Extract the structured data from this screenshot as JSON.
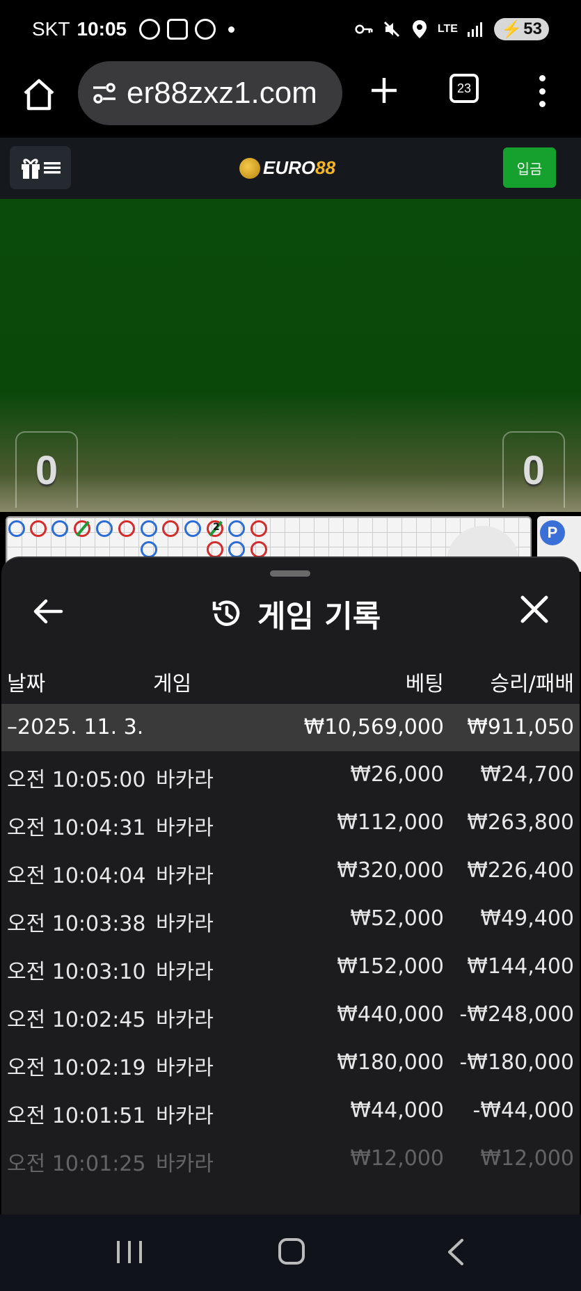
{
  "status_bar": {
    "carrier": "SKT",
    "time": "10:05",
    "network": "LTE",
    "battery": "53"
  },
  "browser": {
    "url": "er88zxz1.com",
    "tab_count": "23"
  },
  "site": {
    "logo_a": "EURO",
    "logo_b": "88",
    "deposit_label": "입금"
  },
  "game": {
    "score_left": "0",
    "score_right": "0",
    "badge": "P",
    "roadmap_tie_count": "2"
  },
  "sheet": {
    "title": "게임 기록",
    "columns": {
      "date": "날짜",
      "game": "게임",
      "bet": "베팅",
      "win_loss": "승리/패배"
    },
    "summary": {
      "date": "–2025. 11. 3.",
      "bet": "₩10,569,000",
      "win_loss": "₩911,050"
    },
    "rows": [
      {
        "time": "오전 10:05:00",
        "game": "바카라",
        "bet": "₩26,000",
        "win_loss": "₩24,700"
      },
      {
        "time": "오전 10:04:31",
        "game": "바카라",
        "bet": "₩112,000",
        "win_loss": "₩263,800"
      },
      {
        "time": "오전 10:04:04",
        "game": "바카라",
        "bet": "₩320,000",
        "win_loss": "₩226,400"
      },
      {
        "time": "오전 10:03:38",
        "game": "바카라",
        "bet": "₩52,000",
        "win_loss": "₩49,400"
      },
      {
        "time": "오전 10:03:10",
        "game": "바카라",
        "bet": "₩152,000",
        "win_loss": "₩144,400"
      },
      {
        "time": "오전 10:02:45",
        "game": "바카라",
        "bet": "₩440,000",
        "win_loss": "-₩248,000"
      },
      {
        "time": "오전 10:02:19",
        "game": "바카라",
        "bet": "₩180,000",
        "win_loss": "-₩180,000"
      },
      {
        "time": "오전 10:01:51",
        "game": "바카라",
        "bet": "₩44,000",
        "win_loss": "-₩44,000"
      },
      {
        "time": "오전 10:01:25",
        "game": "바카라",
        "bet": "₩12,000",
        "win_loss": "₩12,000"
      }
    ]
  },
  "colors": {
    "deposit_green": "#16a02e",
    "logo_gold": "#f5b523",
    "table_green": "#0a4a0a",
    "banker_red": "#d42b2b",
    "player_blue": "#2c6cd6"
  }
}
